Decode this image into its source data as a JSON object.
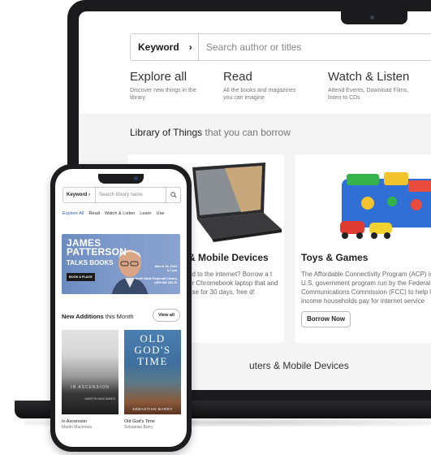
{
  "laptop": {
    "search": {
      "type_label": "Keyword",
      "type_chevron": "›",
      "placeholder": "Search author or titles"
    },
    "explore": [
      {
        "title": "Explore all",
        "desc": "Discover new things in the library"
      },
      {
        "title": "Read",
        "desc": "All the books and magazines you can imagine"
      },
      {
        "title": "Watch & Listen",
        "desc": "Attend Events, Download Films, listen to CDs"
      }
    ],
    "section": {
      "title_bold": "Library of Things",
      "title_muted": "that you can borrow"
    },
    "cards": [
      {
        "title": "& Mobile Devices",
        "desc": "ed to the internet? Borrow a t or Chromebook laptop that and use for 30 days, free d!"
      },
      {
        "title": "Toys & Games",
        "desc": "The Affordable Connectivity Program (ACP) is a U.S. government program run by the Federal Communications Commission (FCC) to help low-income households pay for internet service",
        "button": "Borrow Now"
      }
    ],
    "next_section": "uters & Mobile Devices"
  },
  "phone": {
    "search": {
      "type_label": "Keyword",
      "type_chevron": "›",
      "placeholder": "Search library name"
    },
    "tabs": [
      "Explore All",
      "Read",
      "Watch & Listen",
      "Learn",
      "Use"
    ],
    "banner": {
      "name_line1": "JAMES",
      "name_line2": "PATTERSON",
      "subtitle": "TALKS BOOKS",
      "button": "BOOK A PLACE",
      "date": "March 16, 2024",
      "time": "6-7 pm",
      "venue": "North Dade Regional Library",
      "address": "2455 NW 183 St"
    },
    "new_additions": {
      "bold": "New Additions",
      "muted": "this Month",
      "view_all": "View all"
    },
    "books": [
      {
        "cover_title": "IN ASCENSION",
        "cover_author": "MARTIN MACINNES",
        "title": "In Ascension",
        "author": "Martin MacInnes"
      },
      {
        "cover_title": "OLD GOD'S TIME",
        "cover_author": "SEBASTIAN BARRY",
        "title": "Old God's Time",
        "author": "Sebastian Barry"
      }
    ]
  },
  "colors": {
    "accent_blue": "#2b5fd0",
    "device_frame": "#1b1b1d"
  }
}
